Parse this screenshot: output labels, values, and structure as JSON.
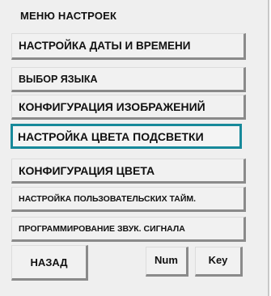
{
  "menu": {
    "title": "МЕНЮ НАСТРОЕК",
    "items": [
      {
        "label": "НАСТРОЙКА ДАТЫ И ВРЕМЕНИ"
      },
      {
        "label": "ВЫБОР ЯЗЫКА"
      },
      {
        "label": "КОНФИГУРАЦИЯ ИЗОБРАЖЕНИЙ"
      },
      {
        "label": "НАСТРОЙКА ЦВЕТА ПОДСВЕТКИ"
      },
      {
        "label": "КОНФИГУРАЦИЯ ЦВЕТА"
      },
      {
        "label": "НАСТРОЙКА ПОЛЬЗОВАТЕЛЬСКИХ ТАЙМ."
      },
      {
        "label": "ПРОГРАММИРОВАНИЕ ЗВУК. СИГНАЛА"
      }
    ],
    "selected_index": 3,
    "highlight_color": "#17899a"
  },
  "footer": {
    "back_label": "НАЗАД",
    "num_label": "Num",
    "key_label": "Key"
  }
}
